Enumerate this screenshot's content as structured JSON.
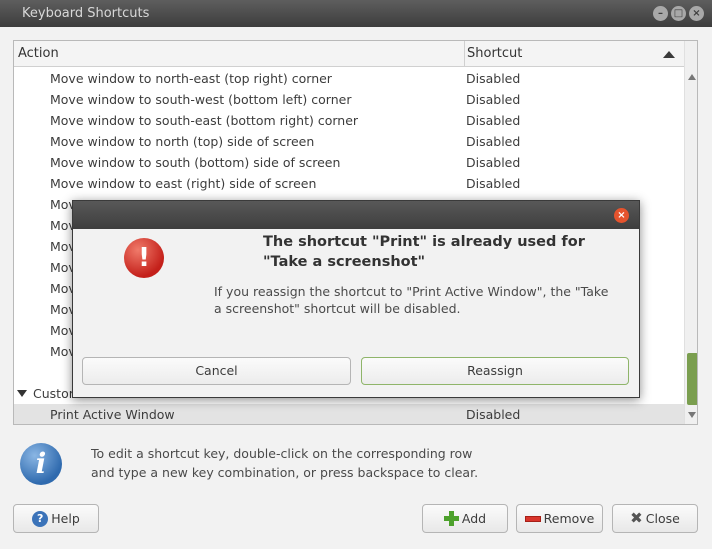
{
  "window": {
    "title": "Keyboard Shortcuts"
  },
  "list": {
    "columns": {
      "action": "Action",
      "shortcut": "Shortcut"
    },
    "rows": [
      {
        "action": "Move window to north-east (top right) corner",
        "shortcut": "Disabled"
      },
      {
        "action": "Move window to south-west (bottom left) corner",
        "shortcut": "Disabled"
      },
      {
        "action": "Move window to south-east (bottom right) corner",
        "shortcut": "Disabled"
      },
      {
        "action": "Move window to north (top) side of screen",
        "shortcut": "Disabled"
      },
      {
        "action": "Move window to south (bottom) side of screen",
        "shortcut": "Disabled"
      },
      {
        "action": "Move window to east (right) side of screen",
        "shortcut": "Disabled"
      },
      {
        "action": "Mov",
        "shortcut": ""
      },
      {
        "action": "Mov",
        "shortcut": ""
      },
      {
        "action": "Mov",
        "shortcut": ""
      },
      {
        "action": "Mov",
        "shortcut": ""
      },
      {
        "action": "Mov",
        "shortcut": ""
      },
      {
        "action": "Mov",
        "shortcut": ""
      },
      {
        "action": "Mov",
        "shortcut": ""
      },
      {
        "action": "Mov",
        "shortcut": ""
      }
    ],
    "group": {
      "label": "Custom"
    },
    "selected": {
      "action": "Print Active Window",
      "shortcut": "Disabled"
    }
  },
  "info": {
    "line1": "To edit a shortcut key, double-click on the corresponding row",
    "line2": "and type a new key combination, or press backspace to clear."
  },
  "buttons": {
    "help": "Help",
    "add": "Add",
    "remove": "Remove",
    "close": "Close"
  },
  "dialog": {
    "heading_line1": "The shortcut \"Print\" is already used for",
    "heading_line2": "\"Take a screenshot\"",
    "body_line1": "If you reassign the shortcut to \"Print Active Window\", the \"Take",
    "body_line2": "a screenshot\" shortcut will be disabled.",
    "cancel": "Cancel",
    "reassign": "Reassign"
  },
  "icons": {
    "window_controls": [
      "minimize-icon",
      "maximize-icon",
      "close-icon"
    ],
    "info": "info-icon",
    "error": "error-icon",
    "help": "help-icon",
    "add": "add-icon",
    "remove": "remove-icon",
    "close": "close-icon"
  },
  "colors": {
    "accent": "#7a9e4f",
    "error": "#c4201a",
    "info": "#2f6aae",
    "titlebar": "#4a4a4a"
  }
}
